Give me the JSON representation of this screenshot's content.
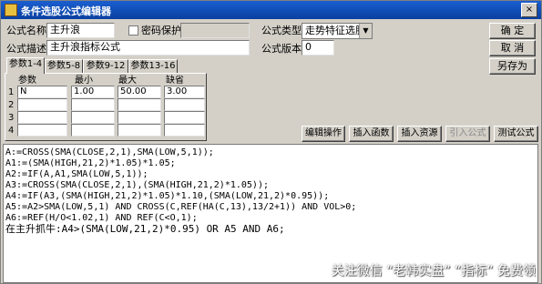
{
  "window": {
    "title": "条件选股公式编辑器",
    "close_label": "×"
  },
  "form": {
    "name_label": "公式名称",
    "name_value": "主升浪",
    "password_label": "密码保护",
    "desc_label": "公式描述",
    "desc_value": "主升浪指标公式",
    "type_label": "公式类型",
    "type_value": "走势特征选股",
    "version_label": "公式版本",
    "version_value": "0"
  },
  "buttons": {
    "ok": "确  定",
    "cancel": "取  消",
    "save_as": "另存为"
  },
  "tabs": [
    "参数1-4",
    "参数5-8",
    "参数9-12",
    "参数13-16"
  ],
  "params": {
    "headers": [
      "参数",
      "最小",
      "最大",
      "缺省"
    ],
    "row_numbers": [
      "1",
      "2",
      "3",
      "4"
    ],
    "rows": [
      [
        "N",
        "1.00",
        "50.00",
        "3.00"
      ],
      [
        "",
        "",
        "",
        ""
      ],
      [
        "",
        "",
        "",
        ""
      ],
      [
        "",
        "",
        "",
        ""
      ]
    ]
  },
  "actions": {
    "edit": "编辑操作",
    "insert_func": "插入函数",
    "insert_res": "插入资源",
    "ref_formula": "引入公式",
    "test_formula": "测试公式"
  },
  "code_lines": [
    "A:=CROSS(SMA(CLOSE,2,1),SMA(LOW,5,1));",
    "A1:=(SMA(HIGH,21,2)*1.05)*1.05;",
    "A2:=IF(A,A1,SMA(LOW,5,1));",
    "A3:=CROSS(SMA(CLOSE,2,1),(SMA(HIGH,21,2)*1.05));",
    "A4:=IF(A3,(SMA(HIGH,21,2)*1.05)*1.10,(SMA(LOW,21,2)*0.95));",
    "A5:=A2>SMA(LOW,5,1) AND CROSS(C,REF(HA(C,13),13/2+1)) AND VOL>0;",
    "A6:=REF(H/O<1.02,1) AND REF(C<O,1);",
    "在主升抓牛:A4>(SMA(LOW,21,2)*0.95) OR A5 AND A6;"
  ],
  "watermark": "关注微信 “老韩实盘” “指标” 免费领"
}
